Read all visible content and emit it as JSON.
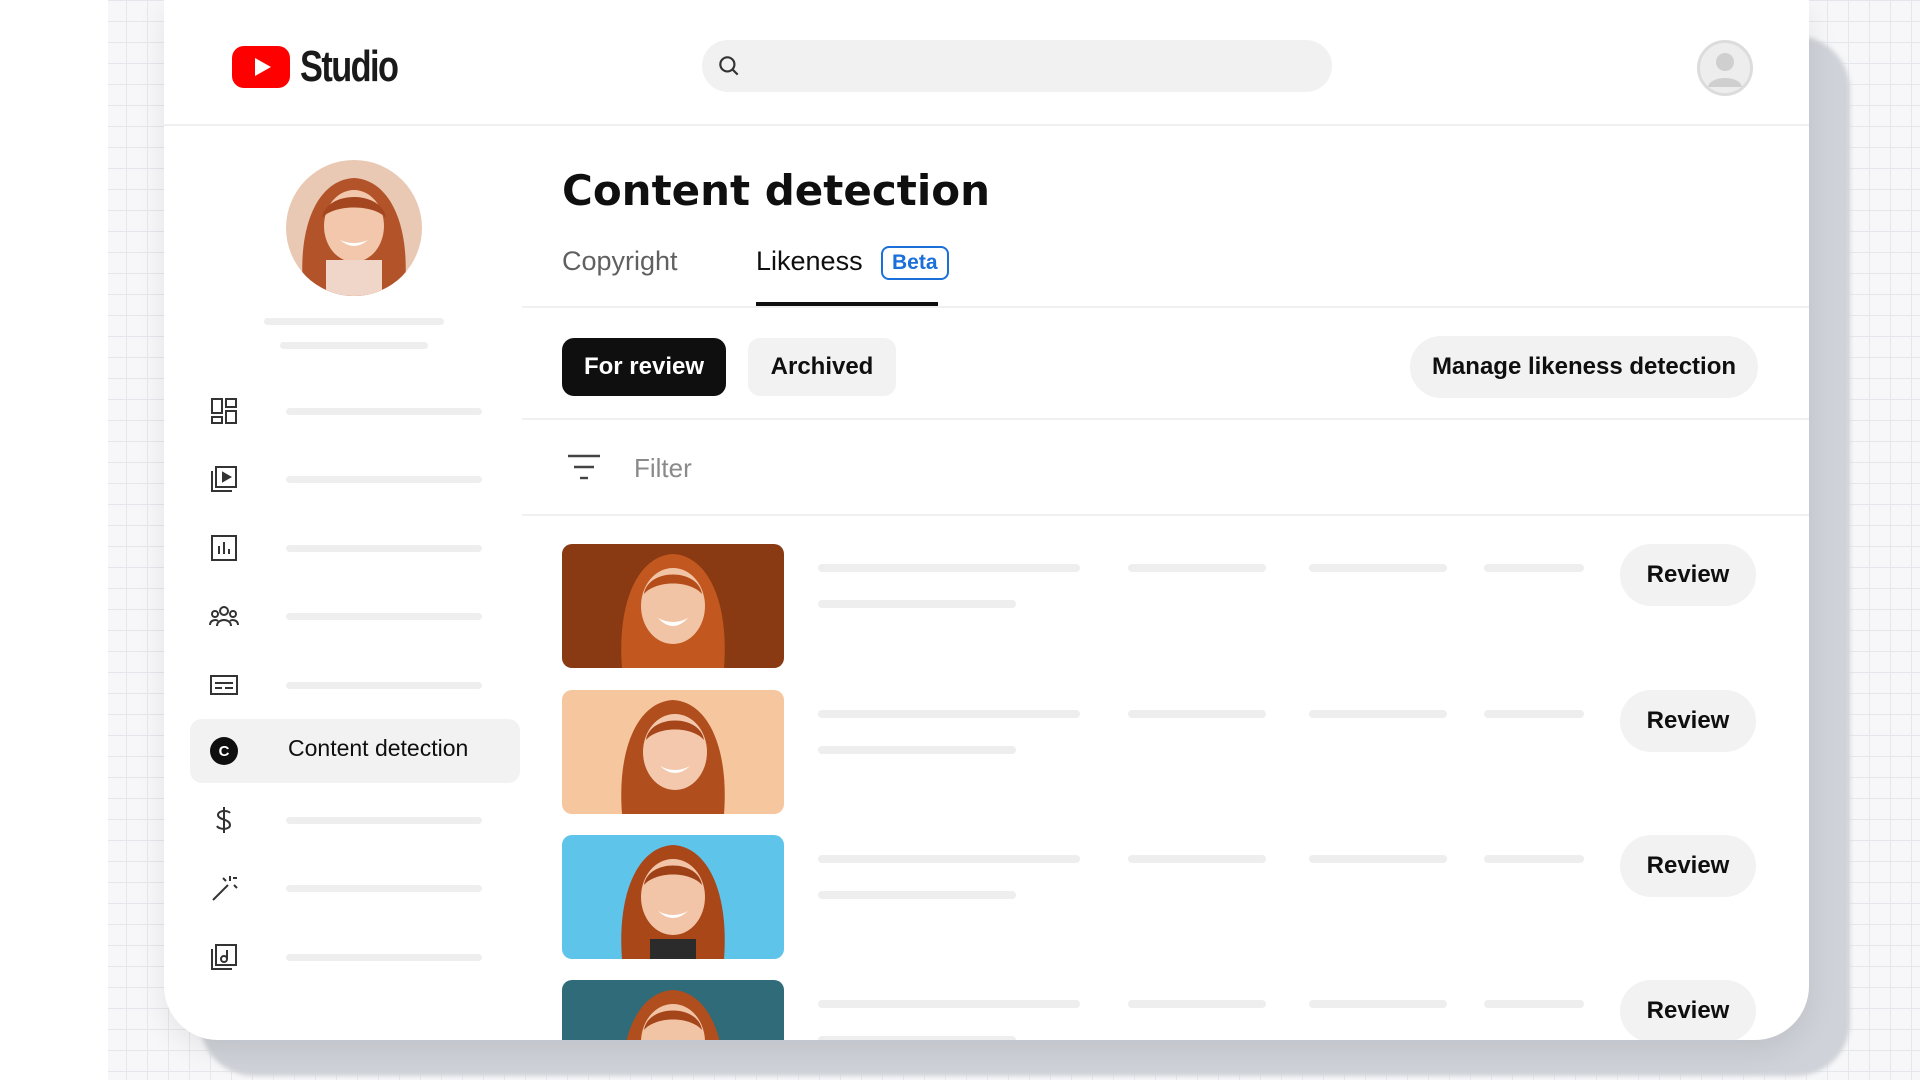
{
  "app": {
    "brand": "Studio",
    "accent_color": "#ff0000"
  },
  "header": {
    "search_placeholder": "",
    "search_icon": "search-icon",
    "account_icon": "account-circle-icon"
  },
  "sidebar": {
    "items": [
      {
        "icon": "dashboard-icon",
        "label": ""
      },
      {
        "icon": "content-icon",
        "label": ""
      },
      {
        "icon": "analytics-icon",
        "label": ""
      },
      {
        "icon": "community-icon",
        "label": ""
      },
      {
        "icon": "subtitles-icon",
        "label": ""
      },
      {
        "icon": "content-detection-icon",
        "label": "Content detection",
        "active": true
      },
      {
        "icon": "earn-icon",
        "label": ""
      },
      {
        "icon": "customization-icon",
        "label": ""
      },
      {
        "icon": "audio-library-icon",
        "label": ""
      }
    ]
  },
  "main": {
    "title": "Content detection",
    "tabs": [
      {
        "label": "Copyright",
        "selected": false
      },
      {
        "label": "Likeness",
        "selected": true,
        "badge": "Beta"
      }
    ],
    "chips": [
      {
        "label": "For review",
        "selected": true
      },
      {
        "label": "Archived",
        "selected": false
      }
    ],
    "manage_button": "Manage likeness detection",
    "filter_label": "Filter",
    "rows": [
      {
        "thumb_bg": "#8a3a12",
        "action": "Review"
      },
      {
        "thumb_bg": "#f6c79f",
        "action": "Review"
      },
      {
        "thumb_bg": "#5fc4ea",
        "action": "Review"
      },
      {
        "thumb_bg": "#2f6b78",
        "action": "Review"
      }
    ]
  }
}
